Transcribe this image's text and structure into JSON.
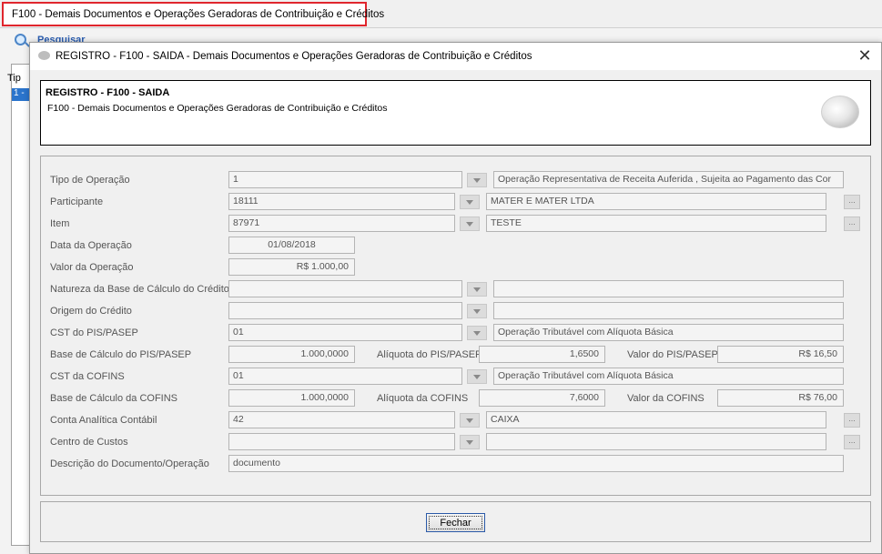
{
  "tab": {
    "title": "F100 - Demais Documentos e Operações Geradoras de Contribuição e Créditos"
  },
  "background": {
    "search_label": "Pesquisar",
    "col_header": "Tip",
    "row_text": "1 -"
  },
  "dialog": {
    "title": "REGISTRO - F100 - SAIDA - Demais Documentos e Operações Geradoras de Contribuição e Créditos",
    "close_symbol": "✕",
    "header_title": "REGISTRO - F100 - SAIDA",
    "header_subtitle": "F100 - Demais Documentos e Operações Geradoras de Contribuição e Créditos",
    "close_button": "Fechar"
  },
  "form": {
    "tipo_operacao": {
      "label": "Tipo de Operação",
      "code": "1",
      "desc": "Operação Representativa de Receita Auferida , Sujeita  ao Pagamento das Cor"
    },
    "participante": {
      "label": "Participante",
      "code": "18111",
      "desc": "MATER E MATER LTDA"
    },
    "item": {
      "label": "Item",
      "code": "87971",
      "desc": "TESTE"
    },
    "data_operacao": {
      "label": "Data da Operação",
      "value": "01/08/2018"
    },
    "valor_operacao": {
      "label": "Valor da Operação",
      "value": "R$ 1.000,00"
    },
    "natureza_base": {
      "label": "Natureza da Base de Cálculo do Crédito",
      "code": "",
      "desc": ""
    },
    "origem_credito": {
      "label": "Origem do Crédito",
      "code": "",
      "desc": ""
    },
    "cst_pis": {
      "label": "CST do PIS/PASEP",
      "code": "01",
      "desc": "Operação Tributável com Alíquota Básica"
    },
    "base_pis": {
      "label": "Base de Cálculo do PIS/PASEP",
      "value": "1.000,0000"
    },
    "aliquota_pis": {
      "label": "Alíquota do PIS/PASEP",
      "value": "1,6500"
    },
    "valor_pis": {
      "label": "Valor do PIS/PASEP",
      "value": "R$ 16,50"
    },
    "cst_cofins": {
      "label": "CST da COFINS",
      "code": "01",
      "desc": "Operação Tributável com Alíquota Básica"
    },
    "base_cofins": {
      "label": "Base de Cálculo da COFINS",
      "value": "1.000,0000"
    },
    "aliquota_cofins": {
      "label": "Alíquota da COFINS",
      "value": "7,6000"
    },
    "valor_cofins": {
      "label": "Valor da COFINS",
      "value": "R$ 76,00"
    },
    "conta_analitica": {
      "label": "Conta Analítica Contábil",
      "code": "42",
      "desc": "CAIXA"
    },
    "centro_custos": {
      "label": "Centro de Custos",
      "code": "",
      "desc": ""
    },
    "descricao": {
      "label": "Descrição do Documento/Operação",
      "value": "documento"
    },
    "lookup_symbol": "..."
  }
}
